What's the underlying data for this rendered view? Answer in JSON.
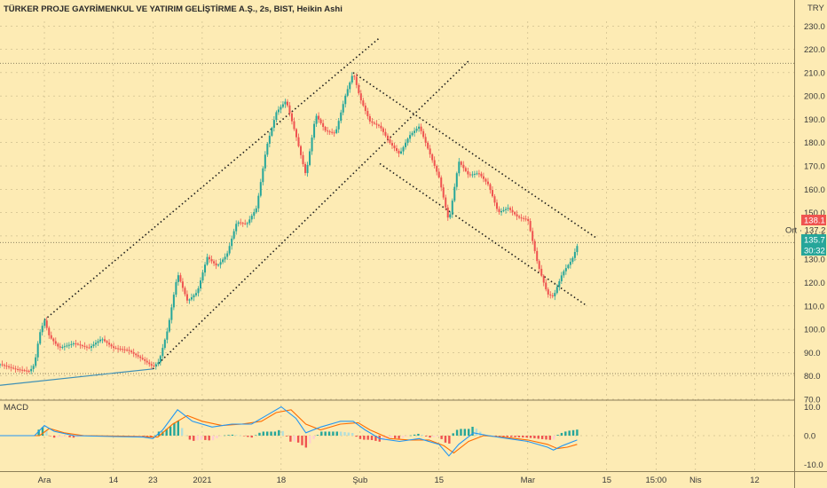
{
  "title": "TÜRKER PROJE GAYRİMENKUL VE YATIRIM GELİŞTİRME A.Ş., 2s, BIST, Heikin Ashi",
  "currency": "TRY",
  "macd_label": "MACD",
  "colors": {
    "background": "#fdebb4",
    "up": "#26a69a",
    "down": "#ef5350",
    "macd_line": "#2196f3",
    "signal_line": "#ff6d00",
    "grid": "#b9aa7c"
  },
  "chart_data": [
    {
      "type": "candlestick",
      "title": "TÜRKER PROJE GAYRİMENKUL VE YATIRIM GELİŞTİRME A.Ş., 2s, BIST, Heikin Ashi",
      "y_ticks": [
        "230.0",
        "220.0",
        "210.0",
        "200.0",
        "190.0",
        "180.0",
        "170.0",
        "160.0",
        "150.0",
        "140.0",
        "130.0",
        "120.0",
        "110.0",
        "100.0",
        "90.0",
        "80.0",
        "70.0"
      ],
      "ylim": [
        70,
        232
      ],
      "x_ticks": [
        "Ara",
        "14",
        "23",
        "2021",
        "18",
        "Şub",
        "15",
        "Mar",
        "15",
        "15:00",
        "Nis",
        "12"
      ],
      "x_tick_positions": [
        1,
        8,
        12,
        17,
        25,
        33,
        41,
        50,
        58,
        63,
        67,
        73
      ],
      "xlim": [
        -3.5,
        77
      ],
      "close_path": [
        {
          "t": -3.5,
          "v": 85
        },
        {
          "t": -2,
          "v": 83
        },
        {
          "t": -0.5,
          "v": 82
        },
        {
          "t": 0,
          "v": 85
        },
        {
          "t": 0.5,
          "v": 98
        },
        {
          "t": 1,
          "v": 104
        },
        {
          "t": 1.5,
          "v": 97
        },
        {
          "t": 2.5,
          "v": 92
        },
        {
          "t": 4,
          "v": 94
        },
        {
          "t": 5.5,
          "v": 92
        },
        {
          "t": 6.8,
          "v": 96
        },
        {
          "t": 8,
          "v": 92
        },
        {
          "t": 9.5,
          "v": 91
        },
        {
          "t": 11,
          "v": 87
        },
        {
          "t": 12,
          "v": 84
        },
        {
          "t": 12.6,
          "v": 86
        },
        {
          "t": 13.5,
          "v": 100
        },
        {
          "t": 14.5,
          "v": 124
        },
        {
          "t": 15.5,
          "v": 112
        },
        {
          "t": 16.5,
          "v": 116
        },
        {
          "t": 17.5,
          "v": 131
        },
        {
          "t": 18.5,
          "v": 127
        },
        {
          "t": 19.5,
          "v": 132
        },
        {
          "t": 20.5,
          "v": 146
        },
        {
          "t": 21.5,
          "v": 145
        },
        {
          "t": 22.5,
          "v": 152
        },
        {
          "t": 23.5,
          "v": 178
        },
        {
          "t": 24.5,
          "v": 193
        },
        {
          "t": 25.5,
          "v": 198
        },
        {
          "t": 26.5,
          "v": 183
        },
        {
          "t": 27.5,
          "v": 166
        },
        {
          "t": 28.5,
          "v": 192
        },
        {
          "t": 29.5,
          "v": 185
        },
        {
          "t": 30.5,
          "v": 184
        },
        {
          "t": 31.5,
          "v": 200
        },
        {
          "t": 32.3,
          "v": 210
        },
        {
          "t": 33,
          "v": 199
        },
        {
          "t": 34,
          "v": 189
        },
        {
          "t": 35,
          "v": 187
        },
        {
          "t": 36,
          "v": 180
        },
        {
          "t": 37,
          "v": 175
        },
        {
          "t": 38,
          "v": 183
        },
        {
          "t": 39,
          "v": 187
        },
        {
          "t": 40,
          "v": 176
        },
        {
          "t": 41,
          "v": 165
        },
        {
          "t": 42,
          "v": 146
        },
        {
          "t": 43,
          "v": 172
        },
        {
          "t": 44,
          "v": 166
        },
        {
          "t": 45,
          "v": 167
        },
        {
          "t": 46,
          "v": 162
        },
        {
          "t": 47,
          "v": 150
        },
        {
          "t": 48,
          "v": 152
        },
        {
          "t": 49,
          "v": 148
        },
        {
          "t": 50,
          "v": 147
        },
        {
          "t": 51,
          "v": 128
        },
        {
          "t": 52,
          "v": 115
        },
        {
          "t": 52.6,
          "v": 114
        },
        {
          "t": 53.5,
          "v": 124
        },
        {
          "t": 54.5,
          "v": 130
        },
        {
          "t": 55,
          "v": 135.7
        }
      ],
      "trendlines": [
        {
          "from": [
            1,
            104
          ],
          "to": [
            35,
            225
          ],
          "style": "dotted"
        },
        {
          "from": [
            12,
            83
          ],
          "to": [
            44,
            215
          ],
          "style": "dotted"
        },
        {
          "from": [
            32.3,
            210
          ],
          "to": [
            57,
            139
          ],
          "style": "dotted"
        },
        {
          "from": [
            35,
            171
          ],
          "to": [
            56,
            110
          ],
          "style": "dotted"
        },
        {
          "from": [
            -3.5,
            76
          ],
          "to": [
            12,
            83
          ],
          "style": "solid"
        }
      ],
      "h_lines": [
        {
          "value": 214,
          "style": "dotted"
        },
        {
          "value": 137.2,
          "style": "dotted"
        },
        {
          "value": 81,
          "style": "dotted"
        }
      ],
      "price_tags": [
        {
          "value": 138.1,
          "label": "138.1",
          "color": "#ef5350"
        },
        {
          "value": 137.2,
          "label": "Ort · 137.2",
          "color": "none"
        },
        {
          "value": 135.7,
          "label": "135.7",
          "color": "#26a69a"
        },
        {
          "value": 130.7,
          "label": "30:32",
          "color": "#26a69a"
        }
      ]
    },
    {
      "type": "line",
      "name": "MACD",
      "y_ticks": [
        "10.0",
        "0.0",
        "-10.0"
      ],
      "ylim": [
        -12,
        12
      ],
      "macd_path": [
        {
          "t": -3.5,
          "v": 0
        },
        {
          "t": 0,
          "v": 0
        },
        {
          "t": 1,
          "v": 3.5
        },
        {
          "t": 2,
          "v": 1.5
        },
        {
          "t": 4,
          "v": 0
        },
        {
          "t": 8,
          "v": -0.3
        },
        {
          "t": 11,
          "v": -0.5
        },
        {
          "t": 12,
          "v": -1
        },
        {
          "t": 13,
          "v": 2
        },
        {
          "t": 14.5,
          "v": 9
        },
        {
          "t": 16,
          "v": 5
        },
        {
          "t": 18,
          "v": 3
        },
        {
          "t": 20,
          "v": 4
        },
        {
          "t": 22,
          "v": 4
        },
        {
          "t": 23.5,
          "v": 7
        },
        {
          "t": 25,
          "v": 10
        },
        {
          "t": 26.5,
          "v": 6
        },
        {
          "t": 27.5,
          "v": 1
        },
        {
          "t": 29,
          "v": 3
        },
        {
          "t": 31,
          "v": 5
        },
        {
          "t": 32.3,
          "v": 5
        },
        {
          "t": 33.5,
          "v": 2
        },
        {
          "t": 35,
          "v": -1
        },
        {
          "t": 37,
          "v": -2
        },
        {
          "t": 39,
          "v": -1
        },
        {
          "t": 41,
          "v": -3
        },
        {
          "t": 42,
          "v": -7
        },
        {
          "t": 43,
          "v": -3
        },
        {
          "t": 44.5,
          "v": 1
        },
        {
          "t": 46,
          "v": 0
        },
        {
          "t": 48,
          "v": -1
        },
        {
          "t": 50,
          "v": -2
        },
        {
          "t": 52,
          "v": -4
        },
        {
          "t": 52.6,
          "v": -5
        },
        {
          "t": 53.5,
          "v": -3.5
        },
        {
          "t": 55,
          "v": -1.5
        }
      ],
      "signal_path": [
        {
          "t": -3.5,
          "v": 0
        },
        {
          "t": 0.5,
          "v": 0
        },
        {
          "t": 1.5,
          "v": 2.5
        },
        {
          "t": 3,
          "v": 1
        },
        {
          "t": 5,
          "v": 0
        },
        {
          "t": 9,
          "v": -0.2
        },
        {
          "t": 12.5,
          "v": -0.5
        },
        {
          "t": 14,
          "v": 4
        },
        {
          "t": 15.5,
          "v": 7
        },
        {
          "t": 17,
          "v": 5
        },
        {
          "t": 19,
          "v": 3.5
        },
        {
          "t": 21,
          "v": 4
        },
        {
          "t": 23,
          "v": 5
        },
        {
          "t": 24.5,
          "v": 8
        },
        {
          "t": 26,
          "v": 9
        },
        {
          "t": 27.5,
          "v": 4
        },
        {
          "t": 29,
          "v": 2
        },
        {
          "t": 31,
          "v": 4
        },
        {
          "t": 32.8,
          "v": 4.5
        },
        {
          "t": 34,
          "v": 2
        },
        {
          "t": 36,
          "v": -1
        },
        {
          "t": 38,
          "v": -1.5
        },
        {
          "t": 40,
          "v": -1.5
        },
        {
          "t": 41.5,
          "v": -3.5
        },
        {
          "t": 42.5,
          "v": -6
        },
        {
          "t": 44,
          "v": -2
        },
        {
          "t": 45.5,
          "v": 0
        },
        {
          "t": 47.5,
          "v": -0.5
        },
        {
          "t": 50,
          "v": -1.5
        },
        {
          "t": 52,
          "v": -3
        },
        {
          "t": 53,
          "v": -4.5
        },
        {
          "t": 54,
          "v": -4
        },
        {
          "t": 55,
          "v": -3
        }
      ]
    }
  ]
}
